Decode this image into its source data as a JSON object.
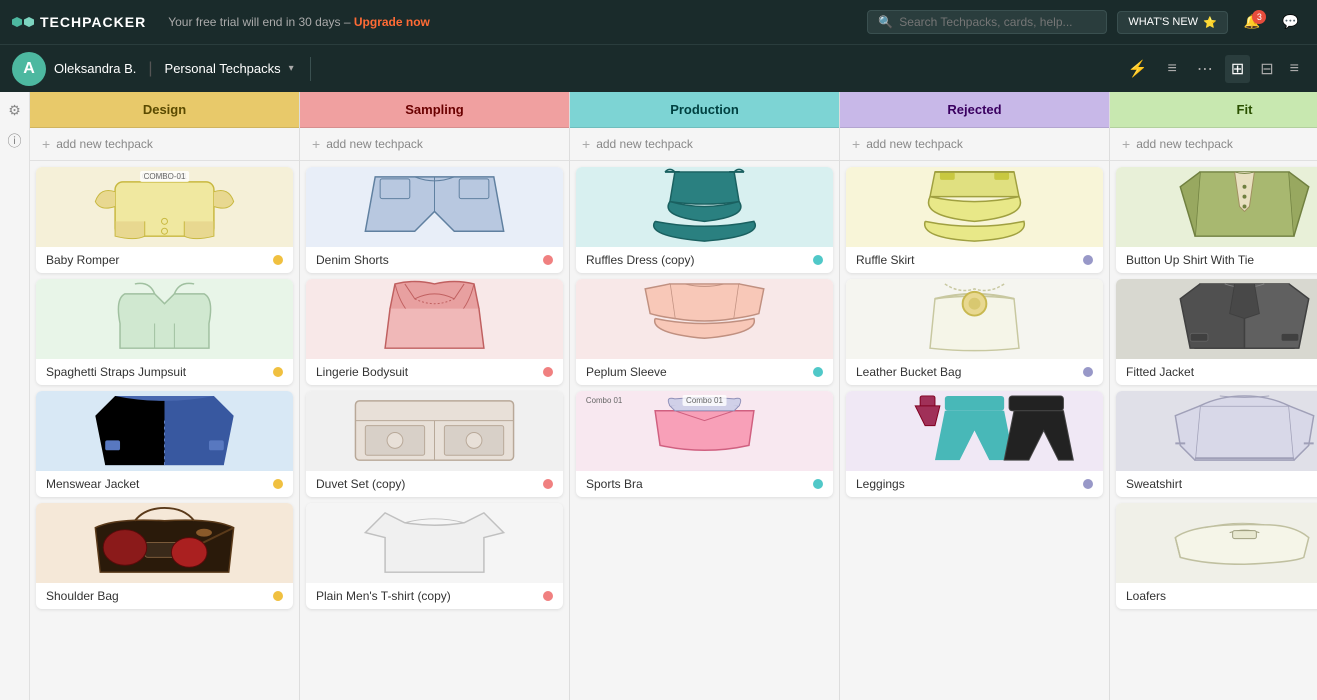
{
  "app": {
    "title": "TECHPACKER",
    "trial_message": "Your free trial will end in 30 days –",
    "upgrade_label": "Upgrade now",
    "search_placeholder": "Search Techpacks, cards, help...",
    "whats_new": "WHAT'S NEW"
  },
  "user": {
    "name": "Oleksandra B.",
    "workspace": "Personal Techpacks",
    "avatar_letter": "A",
    "notifications": "3"
  },
  "columns": [
    {
      "id": "design",
      "label": "Design",
      "add_label": "add new techpack",
      "color_class": "col-design",
      "dot_class": "dot-yellow",
      "cards": [
        {
          "title": "Baby Romper",
          "combo": "COMBO-01",
          "bg": "#f5f0d8"
        },
        {
          "title": "Spaghetti Straps Jumpsuit",
          "bg": "#e8f5e8"
        },
        {
          "title": "Menswear Jacket",
          "bg": "#d8e8f5"
        },
        {
          "title": "Shoulder Bag",
          "bg": "#f5e8d8"
        }
      ]
    },
    {
      "id": "sampling",
      "label": "Sampling",
      "add_label": "add new techpack",
      "color_class": "col-sampling",
      "dot_class": "dot-salmon",
      "cards": [
        {
          "title": "Denim Shorts",
          "bg": "#e8eef8"
        },
        {
          "title": "Lingerie Bodysuit",
          "bg": "#f8e8e8"
        },
        {
          "title": "Duvet Set (copy)",
          "bg": "#f0f0f0"
        },
        {
          "title": "Plain Men's T-shirt (copy)",
          "bg": "#f5f5f5"
        }
      ]
    },
    {
      "id": "production",
      "label": "Production",
      "add_label": "add new techpack",
      "color_class": "col-production",
      "dot_class": "dot-teal",
      "cards": [
        {
          "title": "Ruffles Dress (copy)",
          "bg": "#d8f0f0"
        },
        {
          "title": "Peplum Sleeve",
          "bg": "#f8e8e8"
        },
        {
          "title": "Sports Bra",
          "combo": "Combo 01",
          "bg": "#f8e8f0"
        }
      ]
    },
    {
      "id": "rejected",
      "label": "Rejected",
      "add_label": "add new techpack",
      "color_class": "col-rejected",
      "dot_class": "dot-purple",
      "cards": [
        {
          "title": "Ruffle Skirt",
          "bg": "#f8f5d8"
        },
        {
          "title": "Leather Bucket Bag",
          "bg": "#f5f5f0"
        },
        {
          "title": "Leggings",
          "bg": "#f0e8f5"
        }
      ]
    },
    {
      "id": "fit",
      "label": "Fit",
      "add_label": "add new techpack",
      "color_class": "col-fit",
      "dot_class": "dot-yellow",
      "cards": [
        {
          "title": "Button Up Shirt With Tie",
          "bg": "#e8f0d8"
        },
        {
          "title": "Fitted Jacket",
          "bg": "#d8d8d0"
        },
        {
          "title": "Sweatshirt",
          "bg": "#e0e0e8"
        },
        {
          "title": "Loafers",
          "bg": "#f0f0e8"
        }
      ]
    }
  ]
}
